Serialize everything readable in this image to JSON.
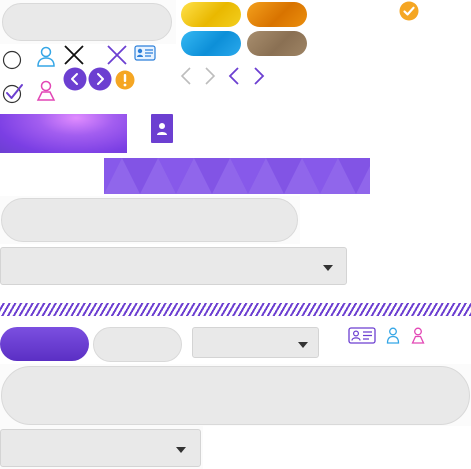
{
  "colors": {
    "accent_purple": "#6c3fd1",
    "light_blue": "#35a6e6",
    "pink": "#e247b5",
    "orange": "#f5a623",
    "gold": "#f2c300",
    "dark_orange": "#e88a00",
    "sky_blue": "#1ea3e8",
    "bronze": "#9c8263",
    "field_grey": "#e9e9e9"
  },
  "icons": {
    "check_circle": "check-circle-icon",
    "radio_unchecked": "radio-unchecked-icon",
    "radio_checked": "radio-checked-icon",
    "user_male": "user-male-icon",
    "user_female": "user-female-icon",
    "close_black": "close-black-icon",
    "close_purple": "close-purple-icon",
    "id_card": "id-card-icon",
    "chevron_left": "chevron-left-icon",
    "chevron_right": "chevron-right-icon",
    "warning": "warning-icon",
    "contact": "contact-icon"
  }
}
